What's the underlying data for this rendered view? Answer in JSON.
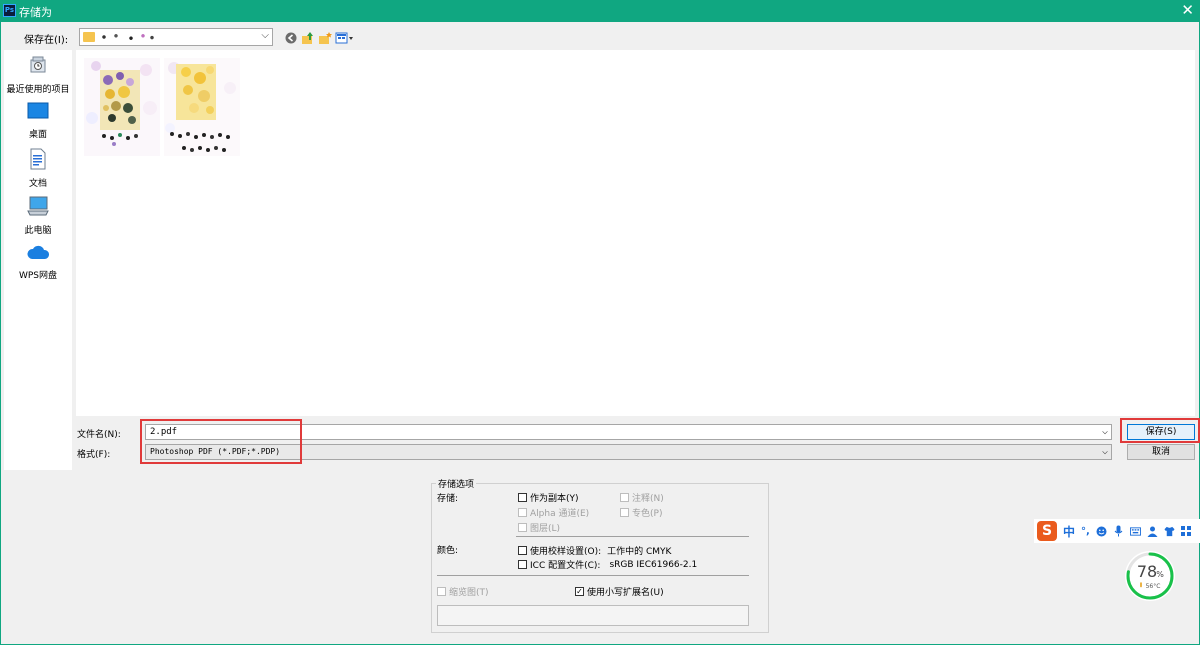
{
  "window": {
    "title": "存储为",
    "app_badge": "Ps"
  },
  "location": {
    "label": "保存在(I):"
  },
  "places": [
    {
      "label": "最近使用的项目",
      "icon": "recent-items-icon"
    },
    {
      "label": "桌面",
      "icon": "desktop-icon"
    },
    {
      "label": "文档",
      "icon": "documents-icon"
    },
    {
      "label": "此电脑",
      "icon": "this-pc-icon"
    },
    {
      "label": "WPS网盘",
      "icon": "wps-cloud-icon"
    }
  ],
  "form": {
    "filename_label": "文件名(N):",
    "filename_value": "2.pdf",
    "format_label": "格式(F):",
    "format_value": "Photoshop PDF (*.PDF;*.PDP)",
    "save_button": "保存(S)",
    "cancel_button": "取消"
  },
  "options": {
    "title": "存储选项",
    "save_label": "存储:",
    "as_copy": "作为副本(Y)",
    "notes": "注释(N)",
    "alpha": "Alpha 通道(E)",
    "spot": "专色(P)",
    "layers": "图层(L)",
    "color_label": "颜色:",
    "proof": "使用校样设置(O):",
    "proof_value": "工作中的 CMYK",
    "icc": "ICC 配置文件(C):",
    "icc_value": "sRGB IEC61966-2.1",
    "thumbnail": "缩览图(T)",
    "lowercase": "使用小写扩展名(U)",
    "checked_mark": "✓"
  },
  "ime": {
    "logo": "S",
    "mode": "中",
    "punct": "°,"
  },
  "gauge": {
    "percent": "78",
    "unit": "%",
    "temp": "56°C",
    "fill": 0.78,
    "color": "#19c14a"
  },
  "colors": {
    "title_bar": "#10a781",
    "highlight": "#e03a3a"
  }
}
